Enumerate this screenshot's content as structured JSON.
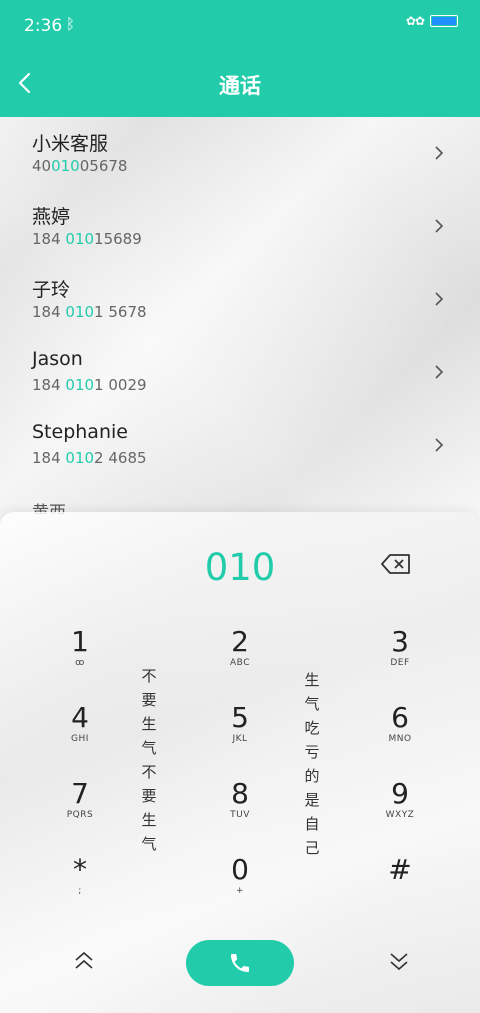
{
  "status_bar": {
    "time": "2:36",
    "bluetooth_icon": "bluetooth-icon",
    "decor": "✿✿",
    "battery_icon": "battery-icon"
  },
  "header": {
    "title": "通话",
    "back_icon": "chevron-left-icon"
  },
  "contacts": [
    {
      "name": "小米客服",
      "number_pre": "40",
      "number_hl": "010",
      "number_post": "05678"
    },
    {
      "name": "燕婷",
      "number_pre": "184 ",
      "number_hl": "010",
      "number_post": "15689"
    },
    {
      "name": "子玲",
      "number_pre": "184 ",
      "number_hl": "010",
      "number_post": "1 5678"
    },
    {
      "name": "Jason",
      "number_pre": "184 ",
      "number_hl": "010",
      "number_post": "1 0029"
    },
    {
      "name": "Stephanie",
      "number_pre": "184 ",
      "number_hl": "010",
      "number_post": "2 4685"
    }
  ],
  "partial_contact": "黄西",
  "dialpad": {
    "input_value": "010",
    "keys": [
      {
        "digit": "1",
        "letters": "ꝏ"
      },
      {
        "digit": "2",
        "letters": "ABC"
      },
      {
        "digit": "3",
        "letters": "DEF"
      },
      {
        "digit": "4",
        "letters": "GHI"
      },
      {
        "digit": "5",
        "letters": "JKL"
      },
      {
        "digit": "6",
        "letters": "MNO"
      },
      {
        "digit": "7",
        "letters": "PQRS"
      },
      {
        "digit": "8",
        "letters": "TUV"
      },
      {
        "digit": "9",
        "letters": "WXYZ"
      },
      {
        "digit": "*",
        "letters": ";"
      },
      {
        "digit": "0",
        "letters": "+"
      },
      {
        "digit": "#",
        "letters": ""
      }
    ],
    "wallpaper_text_left": "不要生气不要生气",
    "wallpaper_text_right": "生气吃亏的是自己"
  },
  "colors": {
    "accent": "#22ccab"
  }
}
